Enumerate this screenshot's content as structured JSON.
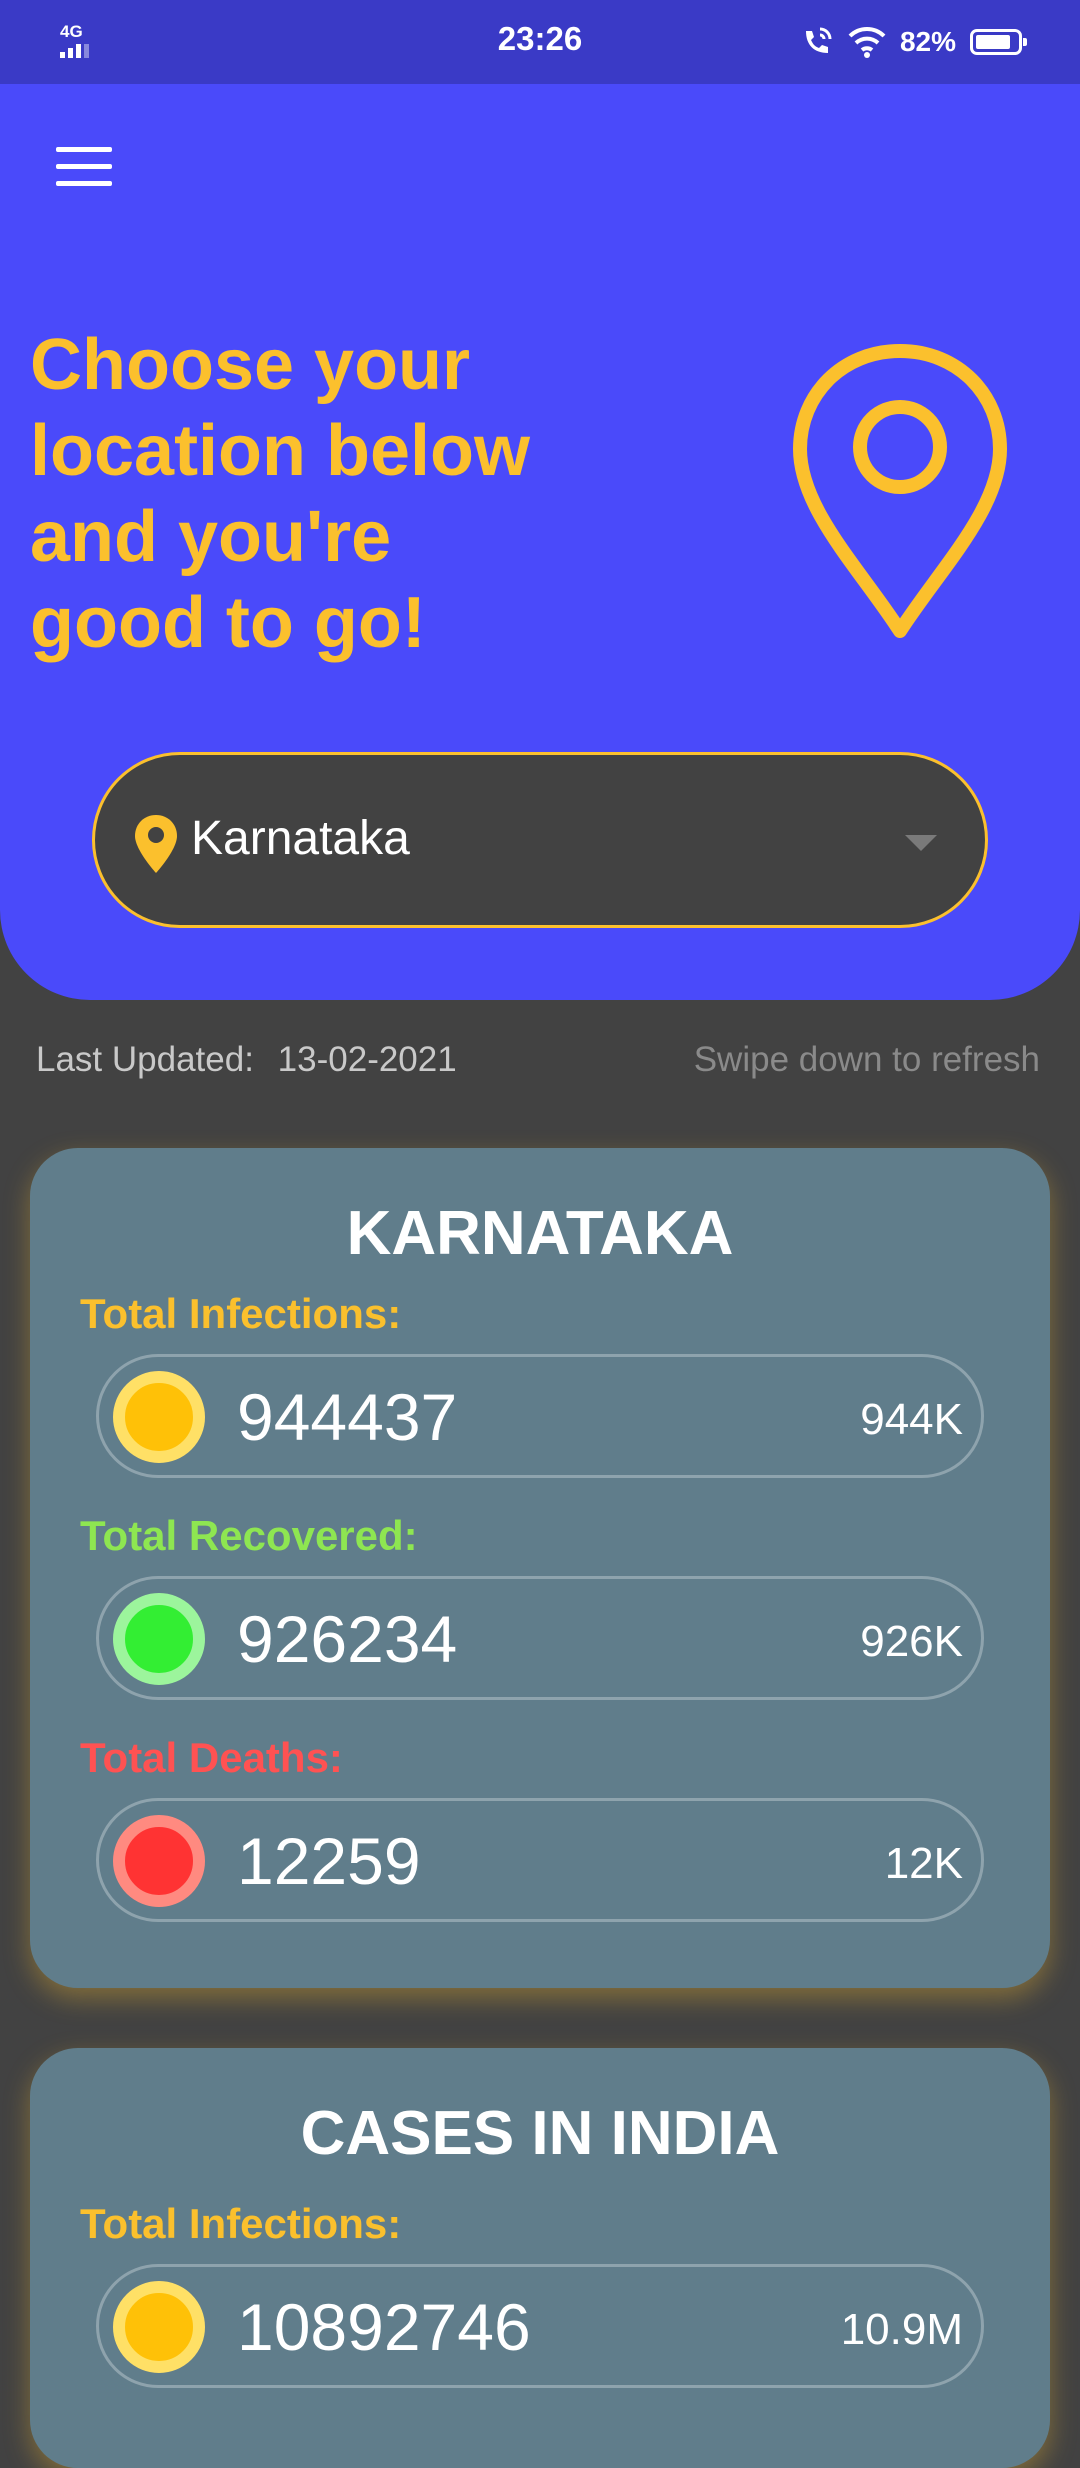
{
  "status_bar": {
    "network": "4G",
    "time": "23:26",
    "battery": "82%"
  },
  "header": {
    "headline": "Choose your\nlocation below\nand you're\ngood to go!",
    "selected_location": "Karnataka"
  },
  "updates": {
    "last_updated_label": "Last Updated:",
    "last_updated_date": "13-02-2021",
    "swipe_hint": "Swipe down to refresh"
  },
  "state_card": {
    "title": "KARNATAKA",
    "infections_label": "Total Infections:",
    "infections_value": "944437",
    "infections_short": "944K",
    "recovered_label": "Total Recovered:",
    "recovered_value": "926234",
    "recovered_short": "926K",
    "deaths_label": "Total Deaths:",
    "deaths_value": "12259",
    "deaths_short": "12K"
  },
  "india_card": {
    "title": "CASES IN INDIA",
    "infections_label": "Total Infections:",
    "infections_value": "10892746",
    "infections_short": "10.9M"
  },
  "colors": {
    "header_bg": "#4a4afa",
    "accent_yellow": "#fbc02d",
    "card_bg": "#607d8b",
    "recovered_green": "#8ee651",
    "deaths_red": "#ff5252"
  }
}
